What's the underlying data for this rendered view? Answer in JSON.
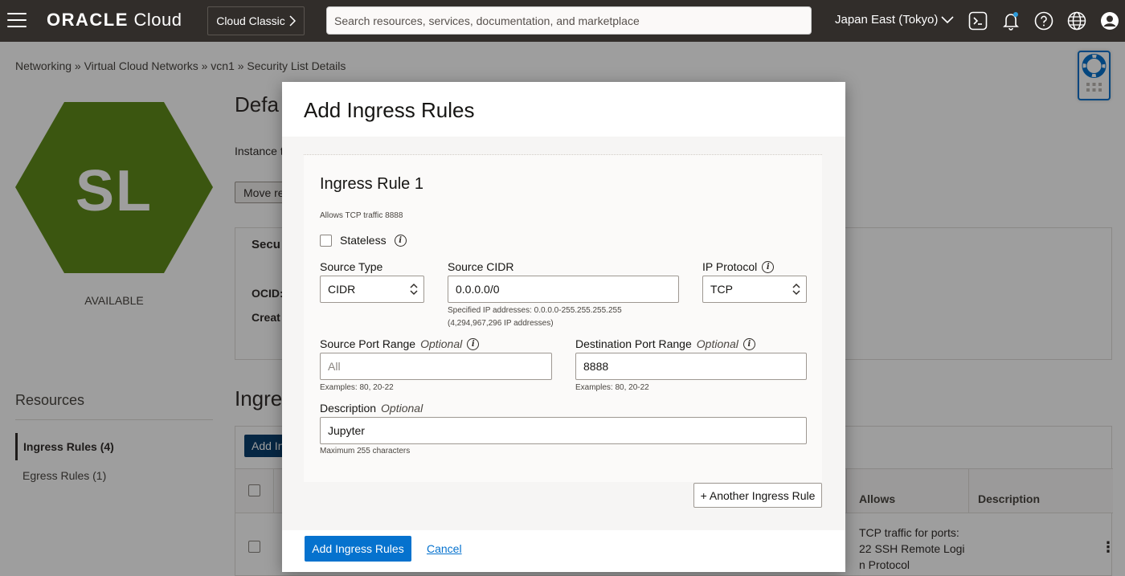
{
  "header": {
    "brand_bold": "ORACLE",
    "brand_light": " Cloud",
    "classic_label": "Cloud Classic",
    "search_placeholder": "Search resources, services, documentation, and marketplace",
    "region": "Japan East (Tokyo)",
    "icons": [
      "cloud-shell-icon",
      "bell-icon",
      "help-icon",
      "globe-icon",
      "user-icon"
    ]
  },
  "page": {
    "breadcrumb": "Networking » Virtual Cloud Networks » vcn1 » Security List Details",
    "badge_text": "SL",
    "badge_color": "#5f8b1b",
    "status": "AVAILABLE",
    "title_partial": "Defa",
    "instance_partial": "Instance t",
    "move_btn_partial": "Move re",
    "panel_tab_partial": "Secu",
    "ocid_label_partial": "OCID:",
    "created_label_partial": "Creat",
    "resources_title": "Resources",
    "resources_items": [
      {
        "label": "Ingress Rules (4)",
        "active": true
      },
      {
        "label": "Egress Rules (1)",
        "active": false
      }
    ],
    "ingress_title_partial": "Ingre",
    "add_btn_partial": "Add In",
    "table_headers": {
      "allows": "Allows",
      "description": "Description"
    },
    "row_allows": "TCP traffic for ports: 22 SSH Remote Logi n Protocol"
  },
  "modal": {
    "title": "Add Ingress Rules",
    "rule": {
      "title": "Ingress Rule 1",
      "subtitle": "Allows TCP traffic 8888",
      "stateless_label": "Stateless",
      "stateless_checked": false,
      "source_type_label": "Source Type",
      "source_type_value": "CIDR",
      "source_cidr_label": "Source CIDR",
      "source_cidr_value": "0.0.0.0/0",
      "source_cidr_hint_1": "Specified IP addresses: 0.0.0.0-255.255.255.255",
      "source_cidr_hint_2": "(4,294,967,296 IP addresses)",
      "ip_protocol_label": "IP Protocol",
      "ip_protocol_value": "TCP",
      "source_port_label": "Source Port Range",
      "optional": "Optional",
      "source_port_placeholder": "All",
      "source_port_hint": "Examples: 80, 20-22",
      "dest_port_label": "Destination Port Range",
      "dest_port_value": "8888",
      "dest_port_hint": "Examples: 80, 20-22",
      "description_label": "Description",
      "description_value": "Jupyter",
      "description_hint": "Maximum 255 characters"
    },
    "another_rule_label": "+ Another Ingress Rule",
    "submit_label": "Add Ingress Rules",
    "cancel_label": "Cancel",
    "accent_color": "#0572ce"
  }
}
